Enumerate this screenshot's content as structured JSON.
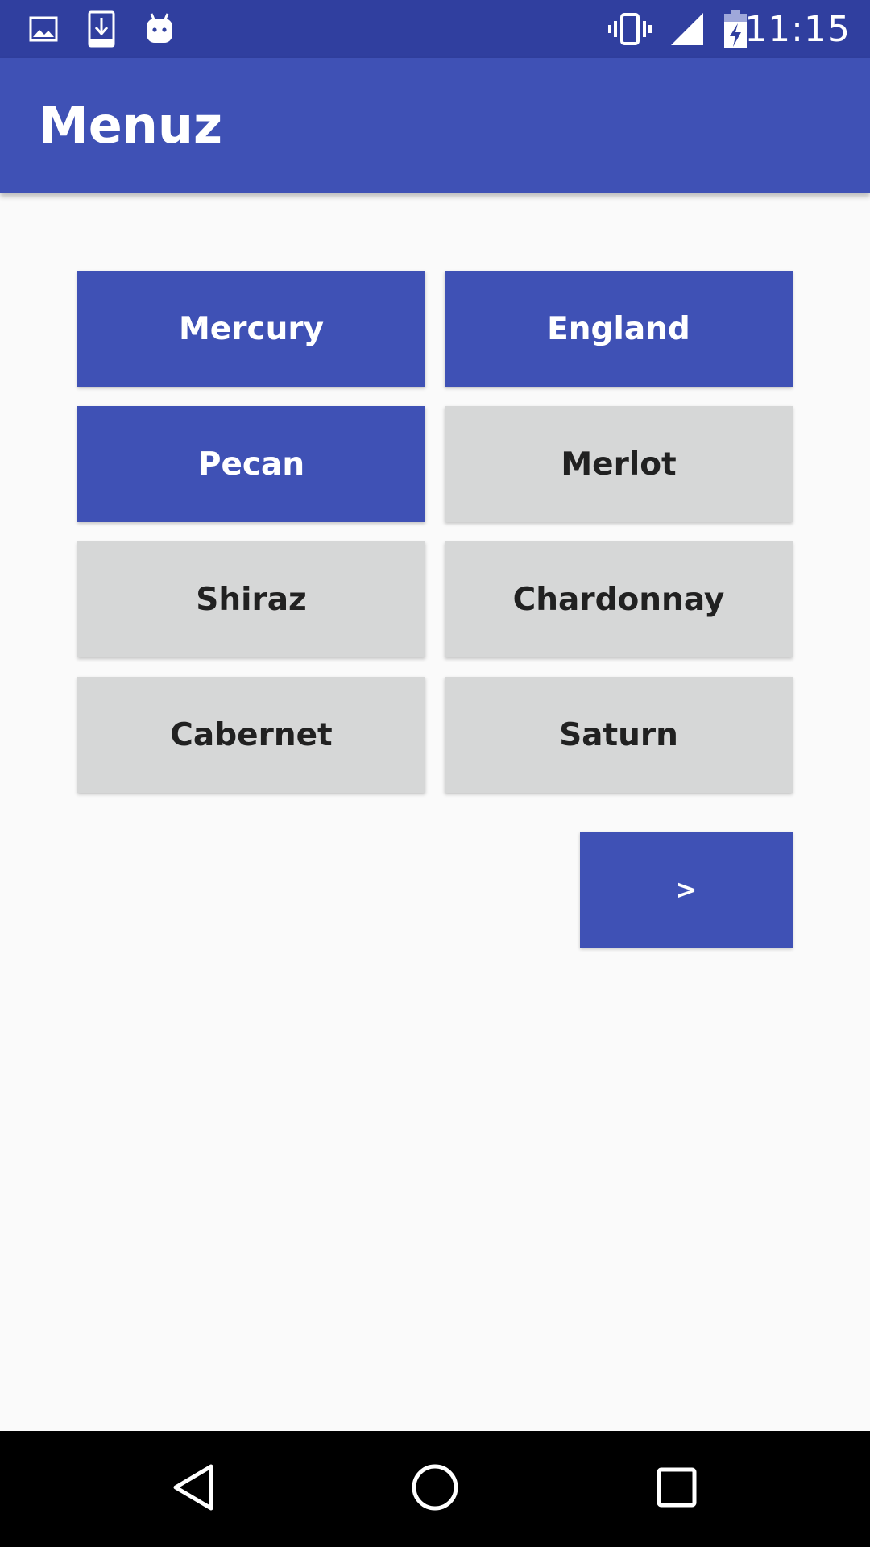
{
  "status_bar": {
    "time": "11:15",
    "left_icons": [
      "gallery-icon",
      "download-icon",
      "android-icon"
    ],
    "right_icons": [
      "vibrate-icon",
      "signal-icon",
      "battery-charging-icon"
    ]
  },
  "app_bar": {
    "title": "Menuz",
    "color": "#3f51b5",
    "status_color": "#303f9f"
  },
  "buttons": [
    {
      "label": "Mercury",
      "selected": true
    },
    {
      "label": "England",
      "selected": true
    },
    {
      "label": "Pecan",
      "selected": true
    },
    {
      "label": "Merlot",
      "selected": false
    },
    {
      "label": "Shiraz",
      "selected": false
    },
    {
      "label": "Chardonnay",
      "selected": false
    },
    {
      "label": "Cabernet",
      "selected": false
    },
    {
      "label": "Saturn",
      "selected": false
    }
  ],
  "next_button": {
    "label": ">"
  },
  "nav_bar": {
    "icons": [
      "back-icon",
      "home-icon",
      "recents-icon"
    ]
  },
  "colors": {
    "selected_bg": "#3f51b5",
    "unselected_bg": "#d6d7d7",
    "page_bg": "#fafafa"
  }
}
